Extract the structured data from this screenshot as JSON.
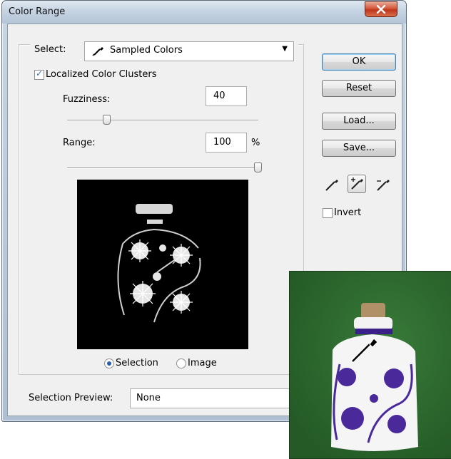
{
  "window": {
    "title": "Color Range"
  },
  "select": {
    "label": "Select:",
    "value": "Sampled Colors"
  },
  "localized": {
    "label": "Localized Color Clusters",
    "checked": true
  },
  "fuzziness": {
    "label": "Fuzziness:",
    "value": "40",
    "slider_fraction": 0.2
  },
  "range": {
    "label": "Range:",
    "value": "100",
    "unit": "%",
    "slider_fraction": 1.0
  },
  "view_mode": {
    "selection_label": "Selection",
    "image_label": "Image",
    "selected": "Selection"
  },
  "buttons": {
    "ok": "OK",
    "reset": "Reset",
    "load": "Load...",
    "save": "Save..."
  },
  "invert": {
    "label": "Invert",
    "checked": false
  },
  "selection_preview": {
    "label": "Selection Preview:",
    "value": "None"
  },
  "icons": [
    "eyedropper-icon",
    "eyedropper-plus-icon",
    "eyedropper-minus-icon",
    "close-icon",
    "dropdown-arrow-icon"
  ],
  "colors": {
    "default_button_border": "#3c7fb1",
    "photo_background": "#2c6a2e",
    "flower_purple": "#4a2a9a"
  }
}
